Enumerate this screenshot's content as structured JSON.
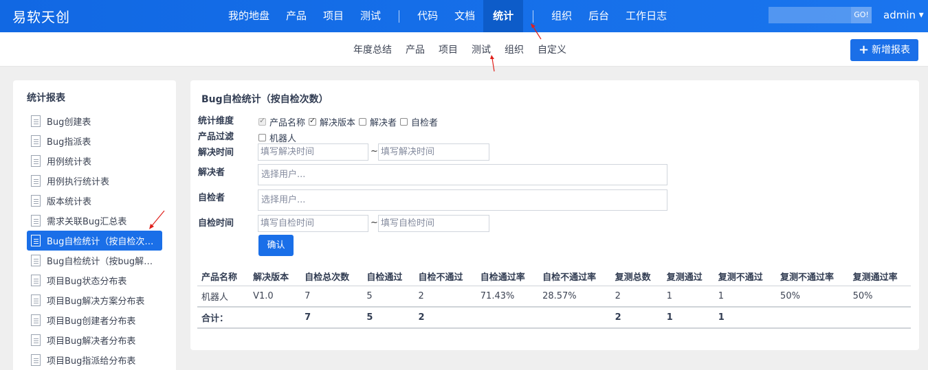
{
  "brand": "易软天创",
  "main_nav": [
    "我的地盘",
    "产品",
    "项目",
    "测试",
    "代码",
    "文档",
    "统计",
    "组织",
    "后台",
    "工作日志"
  ],
  "main_nav_active": "统计",
  "search": {
    "go_label": "GO!"
  },
  "user": {
    "name": "admin"
  },
  "sub_nav": [
    "年度总结",
    "产品",
    "项目",
    "测试",
    "组织",
    "自定义"
  ],
  "add_report_label": "新增报表",
  "sidebar": {
    "title": "统计报表",
    "items": [
      {
        "label": "Bug创建表"
      },
      {
        "label": "Bug指派表"
      },
      {
        "label": "用例统计表"
      },
      {
        "label": "用例执行统计表"
      },
      {
        "label": "版本统计表"
      },
      {
        "label": "需求关联Bug汇总表"
      },
      {
        "label": "Bug自检统计（按自检次…",
        "active": true
      },
      {
        "label": "Bug自检统计（按bug解…"
      },
      {
        "label": "项目Bug状态分布表"
      },
      {
        "label": "项目Bug解决方案分布表"
      },
      {
        "label": "项目Bug创建者分布表"
      },
      {
        "label": "项目Bug解决者分布表"
      },
      {
        "label": "项目Bug指派给分布表"
      }
    ]
  },
  "report": {
    "title": "Bug自检统计（按自检次数）",
    "labels": {
      "dimension": "统计维度",
      "product_filter": "产品过滤",
      "resolve_time": "解决时间",
      "resolver": "解决者",
      "self_checker": "自检者",
      "self_check_time": "自检时间"
    },
    "dimension_options": [
      {
        "label": "产品名称",
        "checked": true,
        "disabled": true
      },
      {
        "label": "解决版本",
        "checked": true,
        "disabled": false
      },
      {
        "label": "解决者",
        "checked": false,
        "disabled": false
      },
      {
        "label": "自检者",
        "checked": false,
        "disabled": false
      }
    ],
    "product_options": [
      {
        "label": "机器人",
        "checked": false
      }
    ],
    "resolve_time_placeholder": "填写解决时间",
    "user_placeholder": "选择用户...",
    "self_check_time_placeholder": "填写自检时间",
    "tilde": "~",
    "confirm_label": "确认",
    "table": {
      "headers": [
        "产品名称",
        "解决版本",
        "自检总次数",
        "自检通过",
        "自检不通过",
        "自检通过率",
        "自检不通过率",
        "复测总数",
        "复测通过",
        "复测不通过",
        "复测不通过率",
        "复测通过率"
      ],
      "rows": [
        [
          "机器人",
          "V1.0",
          "7",
          "5",
          "2",
          "71.43%",
          "28.57%",
          "2",
          "1",
          "1",
          "50%",
          "50%"
        ]
      ],
      "total": [
        "合计：",
        "",
        "7",
        "5",
        "2",
        "",
        "",
        "2",
        "1",
        "1",
        "",
        ""
      ]
    }
  },
  "colors": {
    "topbar": "#1168e3",
    "active_nav": "#0d5cc9",
    "primary_button": "#1a6fe8",
    "annotation_arrow": "#e0201b"
  }
}
